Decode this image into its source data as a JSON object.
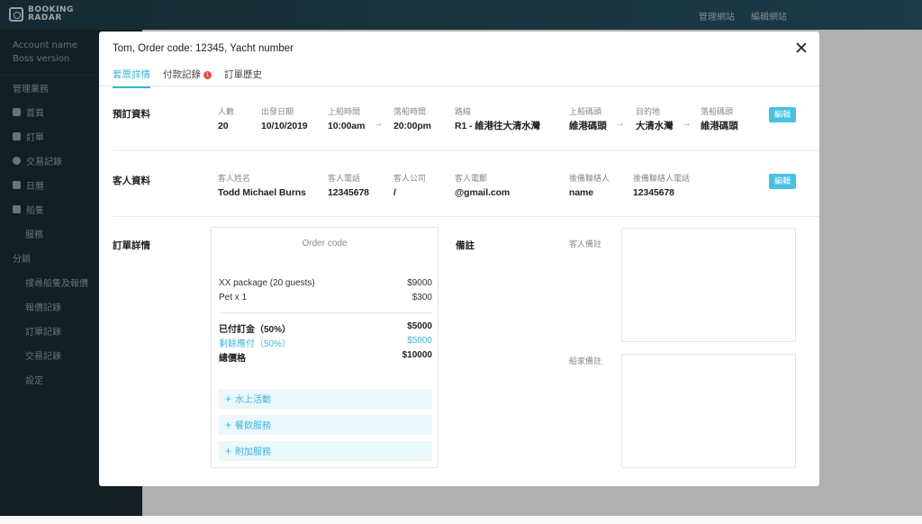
{
  "app": {
    "logo_line1": "BOOKING",
    "logo_line2": "RADAR",
    "top_links": [
      "管理網站",
      "編輯網站"
    ]
  },
  "sidebar": {
    "account_name": "Account name",
    "account_version": "Boss version",
    "items": [
      {
        "label": "管理業務",
        "icon": null,
        "sub": false
      },
      {
        "label": "首頁",
        "icon": "home-icon",
        "sub": false
      },
      {
        "label": "訂單",
        "icon": "document-icon",
        "sub": false
      },
      {
        "label": "交易記錄",
        "icon": "dollar-icon",
        "sub": false
      },
      {
        "label": "日曆",
        "icon": "calendar-icon",
        "sub": false
      },
      {
        "label": "船隻",
        "icon": "boat-icon",
        "sub": false
      },
      {
        "label": "服務",
        "icon": null,
        "sub": true
      },
      {
        "label": "分銷",
        "icon": null,
        "sub": false
      },
      {
        "label": "搜尋船隻及報價",
        "icon": null,
        "sub": true
      },
      {
        "label": "報價記錄",
        "icon": null,
        "sub": true
      },
      {
        "label": "訂單記錄",
        "icon": null,
        "sub": true
      },
      {
        "label": "交易記錄",
        "icon": null,
        "sub": true
      },
      {
        "label": "設定",
        "icon": null,
        "sub": true
      }
    ]
  },
  "modal": {
    "title": "Tom, Order code: 12345,  Yacht number",
    "tabs": [
      {
        "label": "套票詳情",
        "active": true
      },
      {
        "label": "付款記錄",
        "badge": "1"
      },
      {
        "label": "訂單歷史"
      }
    ],
    "booking": {
      "section_title": "預訂資料",
      "edit_label": "編輯",
      "fields": {
        "guests": {
          "label": "人數",
          "value": "20"
        },
        "date": {
          "label": "出發日期",
          "value": "10/10/2019"
        },
        "board_time": {
          "label": "上船時間",
          "value": "10:00am"
        },
        "alight_time": {
          "label": "落船時間",
          "value": "20:00pm"
        },
        "route": {
          "label": "路線",
          "value": "R1 - 維港往大清水灣"
        },
        "board_pier": {
          "label": "上船碼頭",
          "value": "維港碼頭"
        },
        "destination": {
          "label": "目的地",
          "value": "大清水灣"
        },
        "alight_pier": {
          "label": "落船碼頭",
          "value": "維港碼頭"
        }
      }
    },
    "guest": {
      "section_title": "客人資料",
      "edit_label": "編輯",
      "fields": {
        "name": {
          "label": "客人姓名",
          "value": "Todd Michael Burns"
        },
        "phone": {
          "label": "客人電話",
          "value": "12345678"
        },
        "company": {
          "label": "客人公司",
          "value": "/"
        },
        "email": {
          "label": "客人電郵",
          "value": "@gmail.com"
        },
        "backup_contact": {
          "label": "後備聯絡人",
          "value": "name"
        },
        "backup_phone": {
          "label": "後備聯絡人電話",
          "value": "12345678"
        }
      }
    },
    "order": {
      "section_title": "訂單詳情",
      "code_label": "Order code",
      "lines": [
        {
          "label": "XX package (20 guests)",
          "amount": "$9000"
        },
        {
          "label": "Pet x 1",
          "amount": "$300"
        }
      ],
      "deposit": {
        "label": "已付訂金（50%）",
        "amount": "$5000"
      },
      "balance": {
        "label": "剩餘應付（50%）",
        "amount": "$5000"
      },
      "total": {
        "label": "總價格",
        "amount": "$10000"
      },
      "addons": [
        "水上活動",
        "餐飲服務",
        "附加服務"
      ]
    },
    "remarks": {
      "section_title": "備註",
      "guest_label": "客人備註",
      "boat_label": "船家備註"
    }
  },
  "colors": {
    "accent": "#3bb5d6",
    "edit_button": "#49c1e4",
    "badge": "#e54b4b",
    "sidebar_bg": "#1c2a31"
  }
}
